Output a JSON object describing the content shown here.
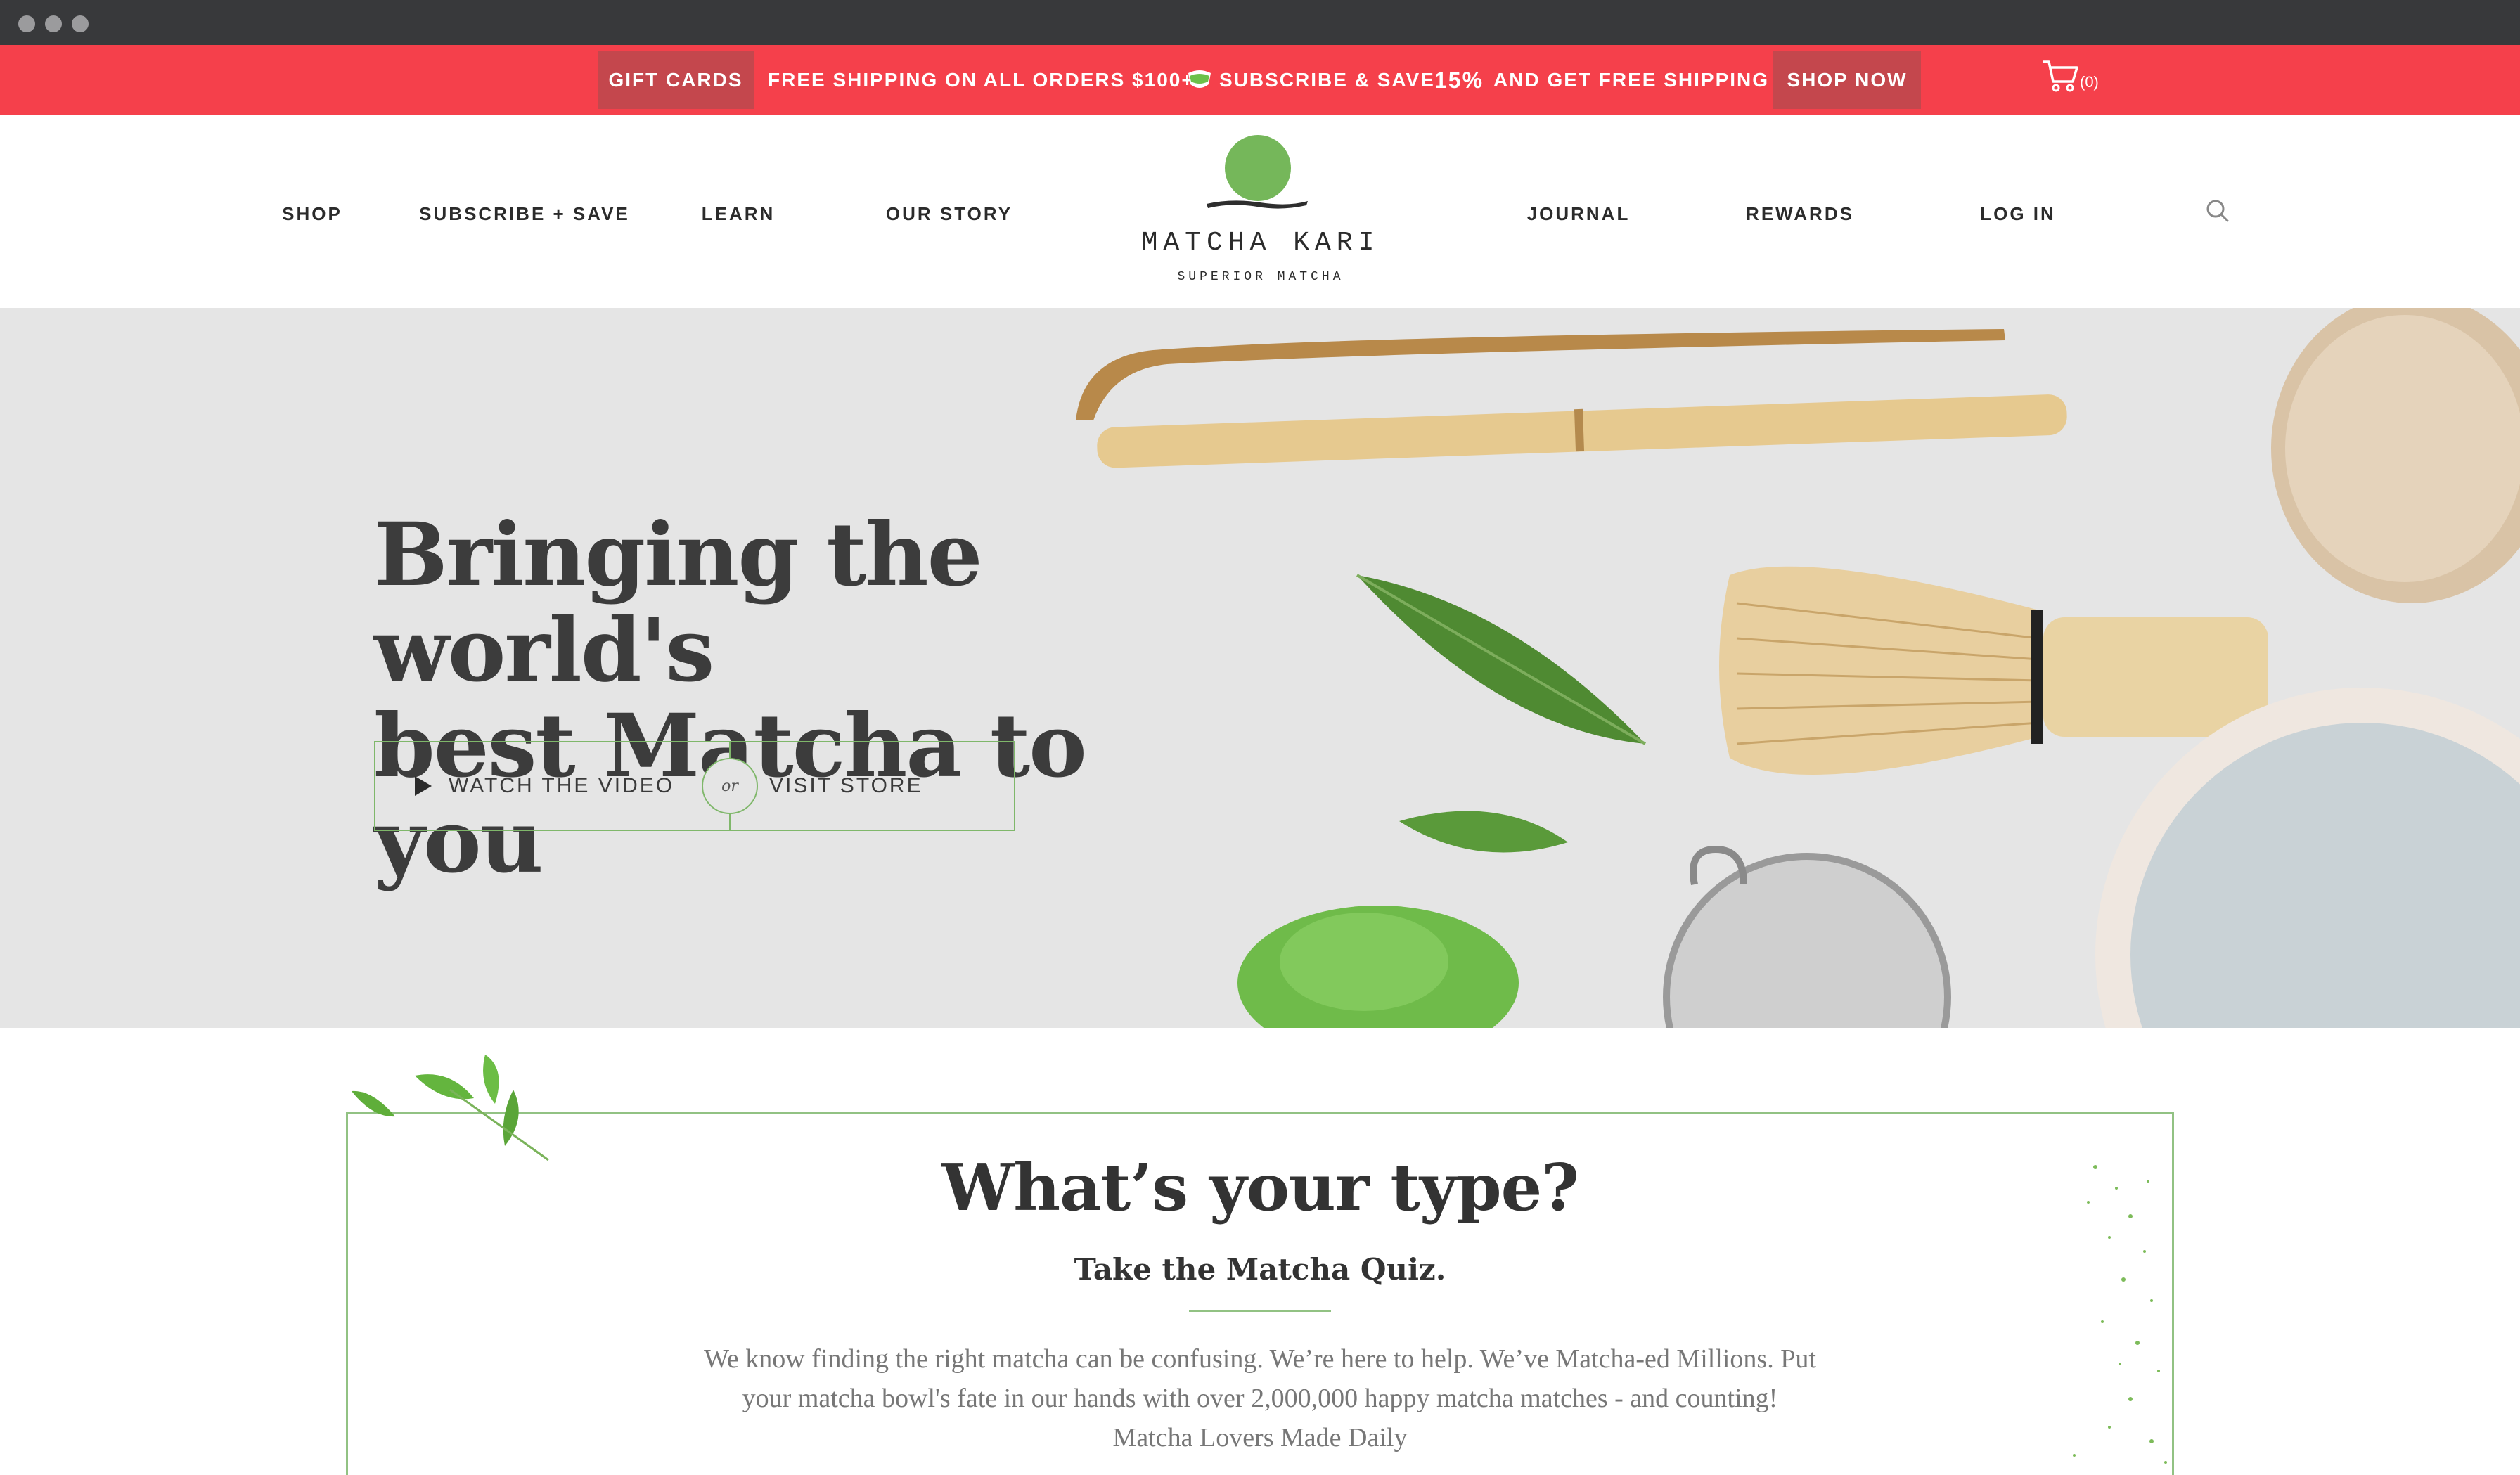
{
  "promo": {
    "gift_cards": "GIFT CARDS",
    "free_shipping": "FREE SHIPPING ON ALL ORDERS $100+",
    "subscribe_save": "SUBSCRIBE & SAVE",
    "percent": "15%",
    "free_shipping_suffix": "AND GET FREE SHIPPING",
    "shop_now": "SHOP NOW",
    "cart_count": "(0)",
    "cart_icon": "cart-icon",
    "colors": {
      "bar": "#f5404b",
      "pill": "#c4474d"
    }
  },
  "nav": {
    "items_left": [
      "SHOP",
      "SUBSCRIBE + SAVE",
      "LEARN",
      "OUR STORY"
    ],
    "items_right": [
      "JOURNAL",
      "REWARDS",
      "LOG IN"
    ],
    "search_icon": "search-icon"
  },
  "logo": {
    "name": "MATCHA KARI",
    "tagline": "SUPERIOR MATCHA",
    "color": "#75b75a"
  },
  "hero": {
    "title_line1": "Bringing the world's",
    "title_line2": "best Matcha to you",
    "watch_video": "WATCH THE VIDEO",
    "or": "or",
    "visit_store": "VISIT STORE",
    "play_icon": "play-icon",
    "accent": "#7fb76a"
  },
  "quiz": {
    "title": "What’s your type?",
    "subtitle": "Take the Matcha Quiz.",
    "body_line1": "We know finding the right matcha can be confusing. We’re here to help. We’ve Matcha-ed Millions. Put",
    "body_line2": "your matcha bowl's fate in our hands with over 2,000,000 happy matcha matches - and counting!",
    "body_line3": "Matcha Lovers Made Daily"
  }
}
